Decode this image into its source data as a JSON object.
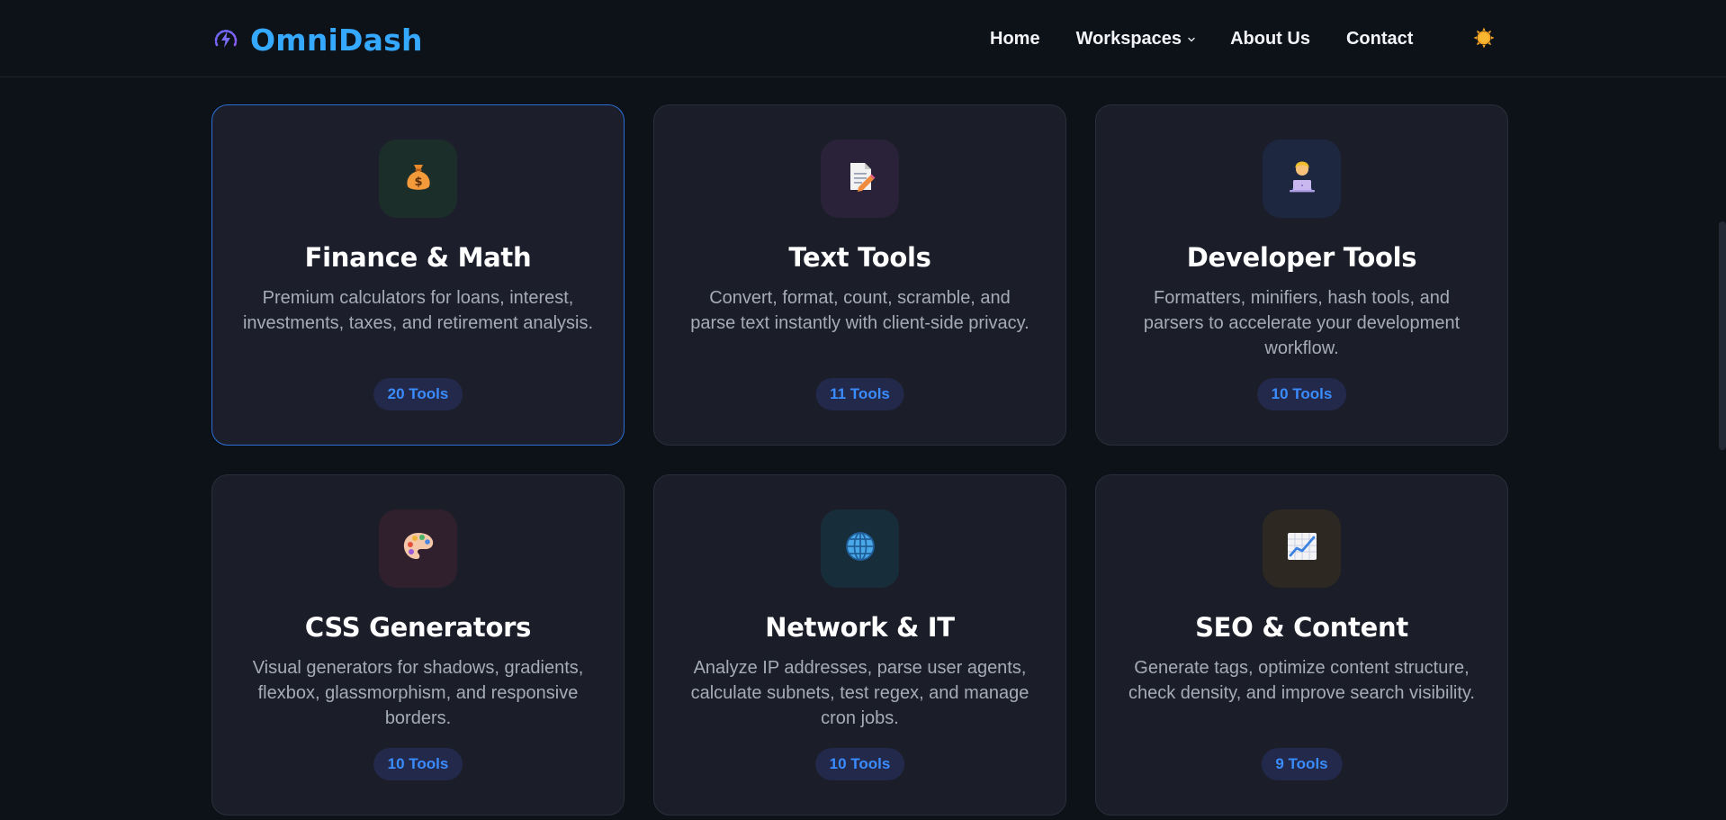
{
  "brand": {
    "name": "OmniDash",
    "color": "#35a8ff",
    "icon": "bolt-gauge-icon"
  },
  "nav": {
    "home": "Home",
    "workspaces": "Workspaces",
    "about": "About Us",
    "contact": "Contact"
  },
  "theme_toggle": {
    "icon": "sun-icon"
  },
  "cards": [
    {
      "title": "Finance & Math",
      "description": "Premium calculators for loans, interest, investments, taxes, and retirement analysis.",
      "count": "20 Tools",
      "icon": "money-bag-icon",
      "icon_bg": "#1c2e2a"
    },
    {
      "title": "Text Tools",
      "description": "Convert, format, count, scramble, and parse text instantly with client-side privacy.",
      "count": "11 Tools",
      "icon": "memo-icon",
      "icon_bg": "#2a2238"
    },
    {
      "title": "Developer Tools",
      "description": "Formatters, minifiers, hash tools, and parsers to accelerate your development workflow.",
      "count": "10 Tools",
      "icon": "technologist-icon",
      "icon_bg": "#1e2740"
    },
    {
      "title": "CSS Generators",
      "description": "Visual generators for shadows, gradients, flexbox, glassmorphism, and responsive borders.",
      "count": "10 Tools",
      "icon": "palette-icon",
      "icon_bg": "#30202d"
    },
    {
      "title": "Network & IT",
      "description": "Analyze IP addresses, parse user agents, calculate subnets, test regex, and manage cron jobs.",
      "count": "10 Tools",
      "icon": "globe-icon",
      "icon_bg": "#182d3a"
    },
    {
      "title": "SEO & Content",
      "description": "Generate tags, optimize content structure, check density, and improve search visibility.",
      "count": "9 Tools",
      "icon": "chart-increasing-icon",
      "icon_bg": "#2d2822"
    }
  ]
}
